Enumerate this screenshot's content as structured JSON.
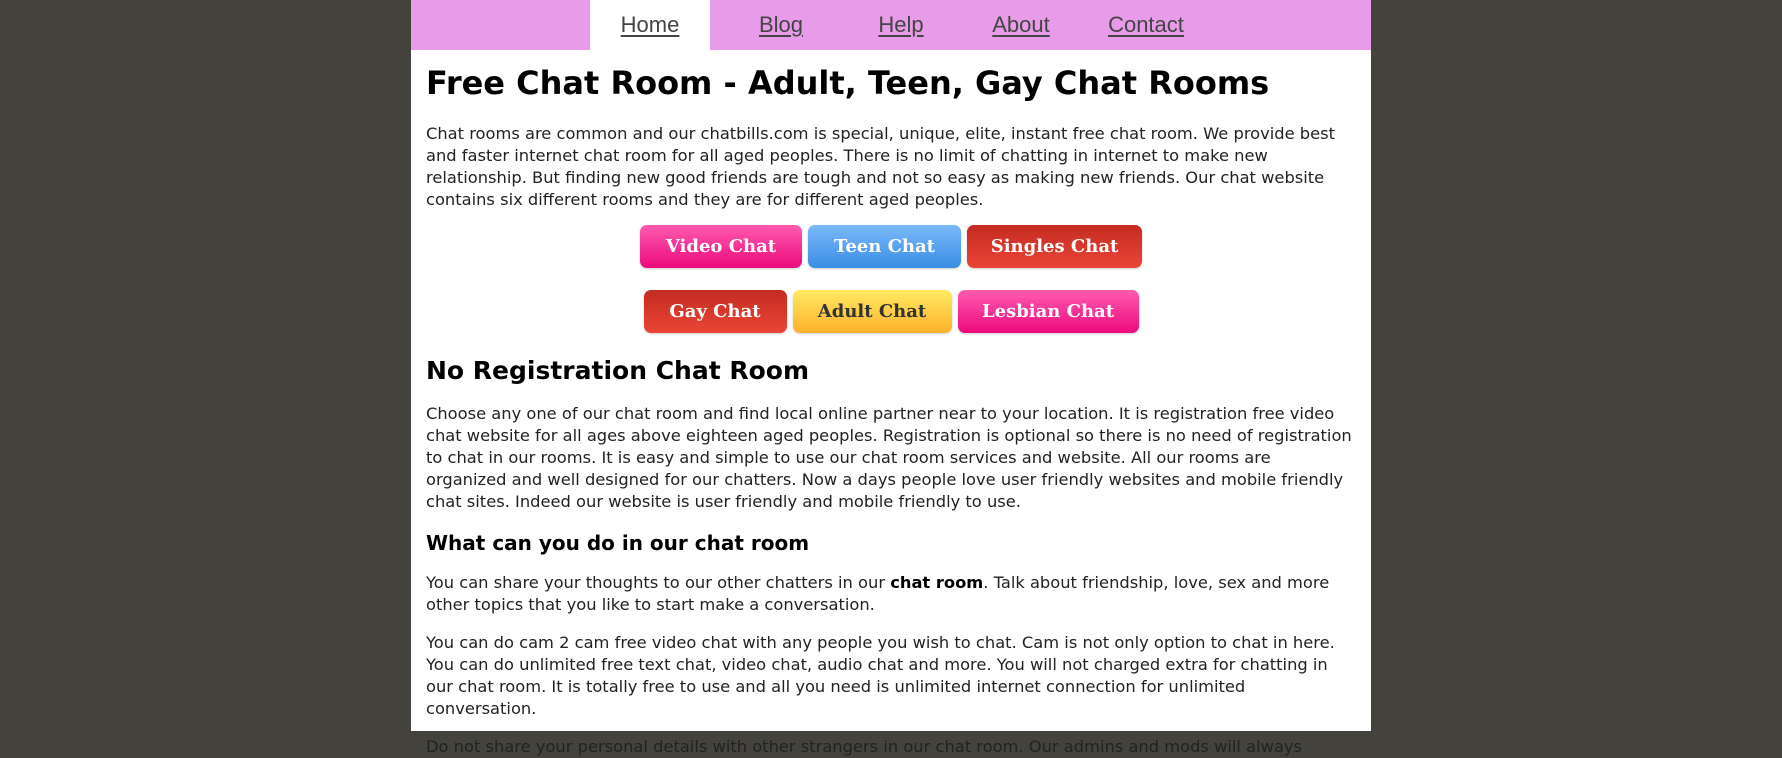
{
  "nav": {
    "items": [
      {
        "label": "Home",
        "active": true
      },
      {
        "label": "Blog",
        "active": false
      },
      {
        "label": "Help",
        "active": false
      },
      {
        "label": "About",
        "active": false
      },
      {
        "label": "Contact",
        "active": false
      }
    ]
  },
  "colors": {
    "background": "#43423c",
    "nav_background": "#e89be8",
    "nav_text": "#444444",
    "button_pink": "#ec0a7c",
    "button_blue": "#3a8ee4",
    "button_red": "#d73a2c",
    "button_yellow": "#fdc845"
  },
  "main": {
    "title": "Free Chat Room - Adult, Teen, Gay Chat Rooms",
    "intro": "Chat rooms are common and our chatbills.com is special, unique, elite, instant free chat room. We provide best and faster internet chat room for all aged peoples. There is no limit of chatting in internet to make new relationship. But finding new good friends are tough and not so easy as making new friends. Our chat website contains six different rooms and they are for different aged peoples.",
    "buttons_row1": [
      {
        "label": "Video Chat",
        "color": "pink"
      },
      {
        "label": "Teen Chat",
        "color": "blue"
      },
      {
        "label": "Singles Chat",
        "color": "red"
      }
    ],
    "buttons_row2": [
      {
        "label": "Gay Chat",
        "color": "red"
      },
      {
        "label": "Adult Chat",
        "color": "yellow"
      },
      {
        "label": "Lesbian Chat",
        "color": "pink"
      }
    ],
    "section2_title": "No Registration Chat Room",
    "section2_text": "Choose any one of our chat room and find local online partner near to your location. It is registration free video chat website for all ages above eighteen aged peoples. Registration is optional so there is no need of registration to chat in our rooms. It is easy and simple to use our chat room services and website. All our rooms are organized and well designed for our chatters. Now a days people love user friendly websites and mobile friendly chat sites. Indeed our website is user friendly and mobile friendly to use.",
    "section3_title": "What can you do in our chat room",
    "section3_p1_before": "You can share your thoughts to our other chatters in our ",
    "section3_p1_bold": "chat room",
    "section3_p1_after": ". Talk about friendship, love, sex and more other topics that you like to start make a conversation.",
    "section3_p2": "You can do cam 2 cam free video chat with any people you wish to chat. Cam is not only option to chat in here. You can do unlimited free text chat, video chat, audio chat and more. You will not charged extra for chatting in our chat room. It is totally free to use and all you need is unlimited internet connection for unlimited conversation.",
    "section3_p3_partial": "Do not share your personal details with other strangers in our chat room. Our admins and mods will always"
  }
}
